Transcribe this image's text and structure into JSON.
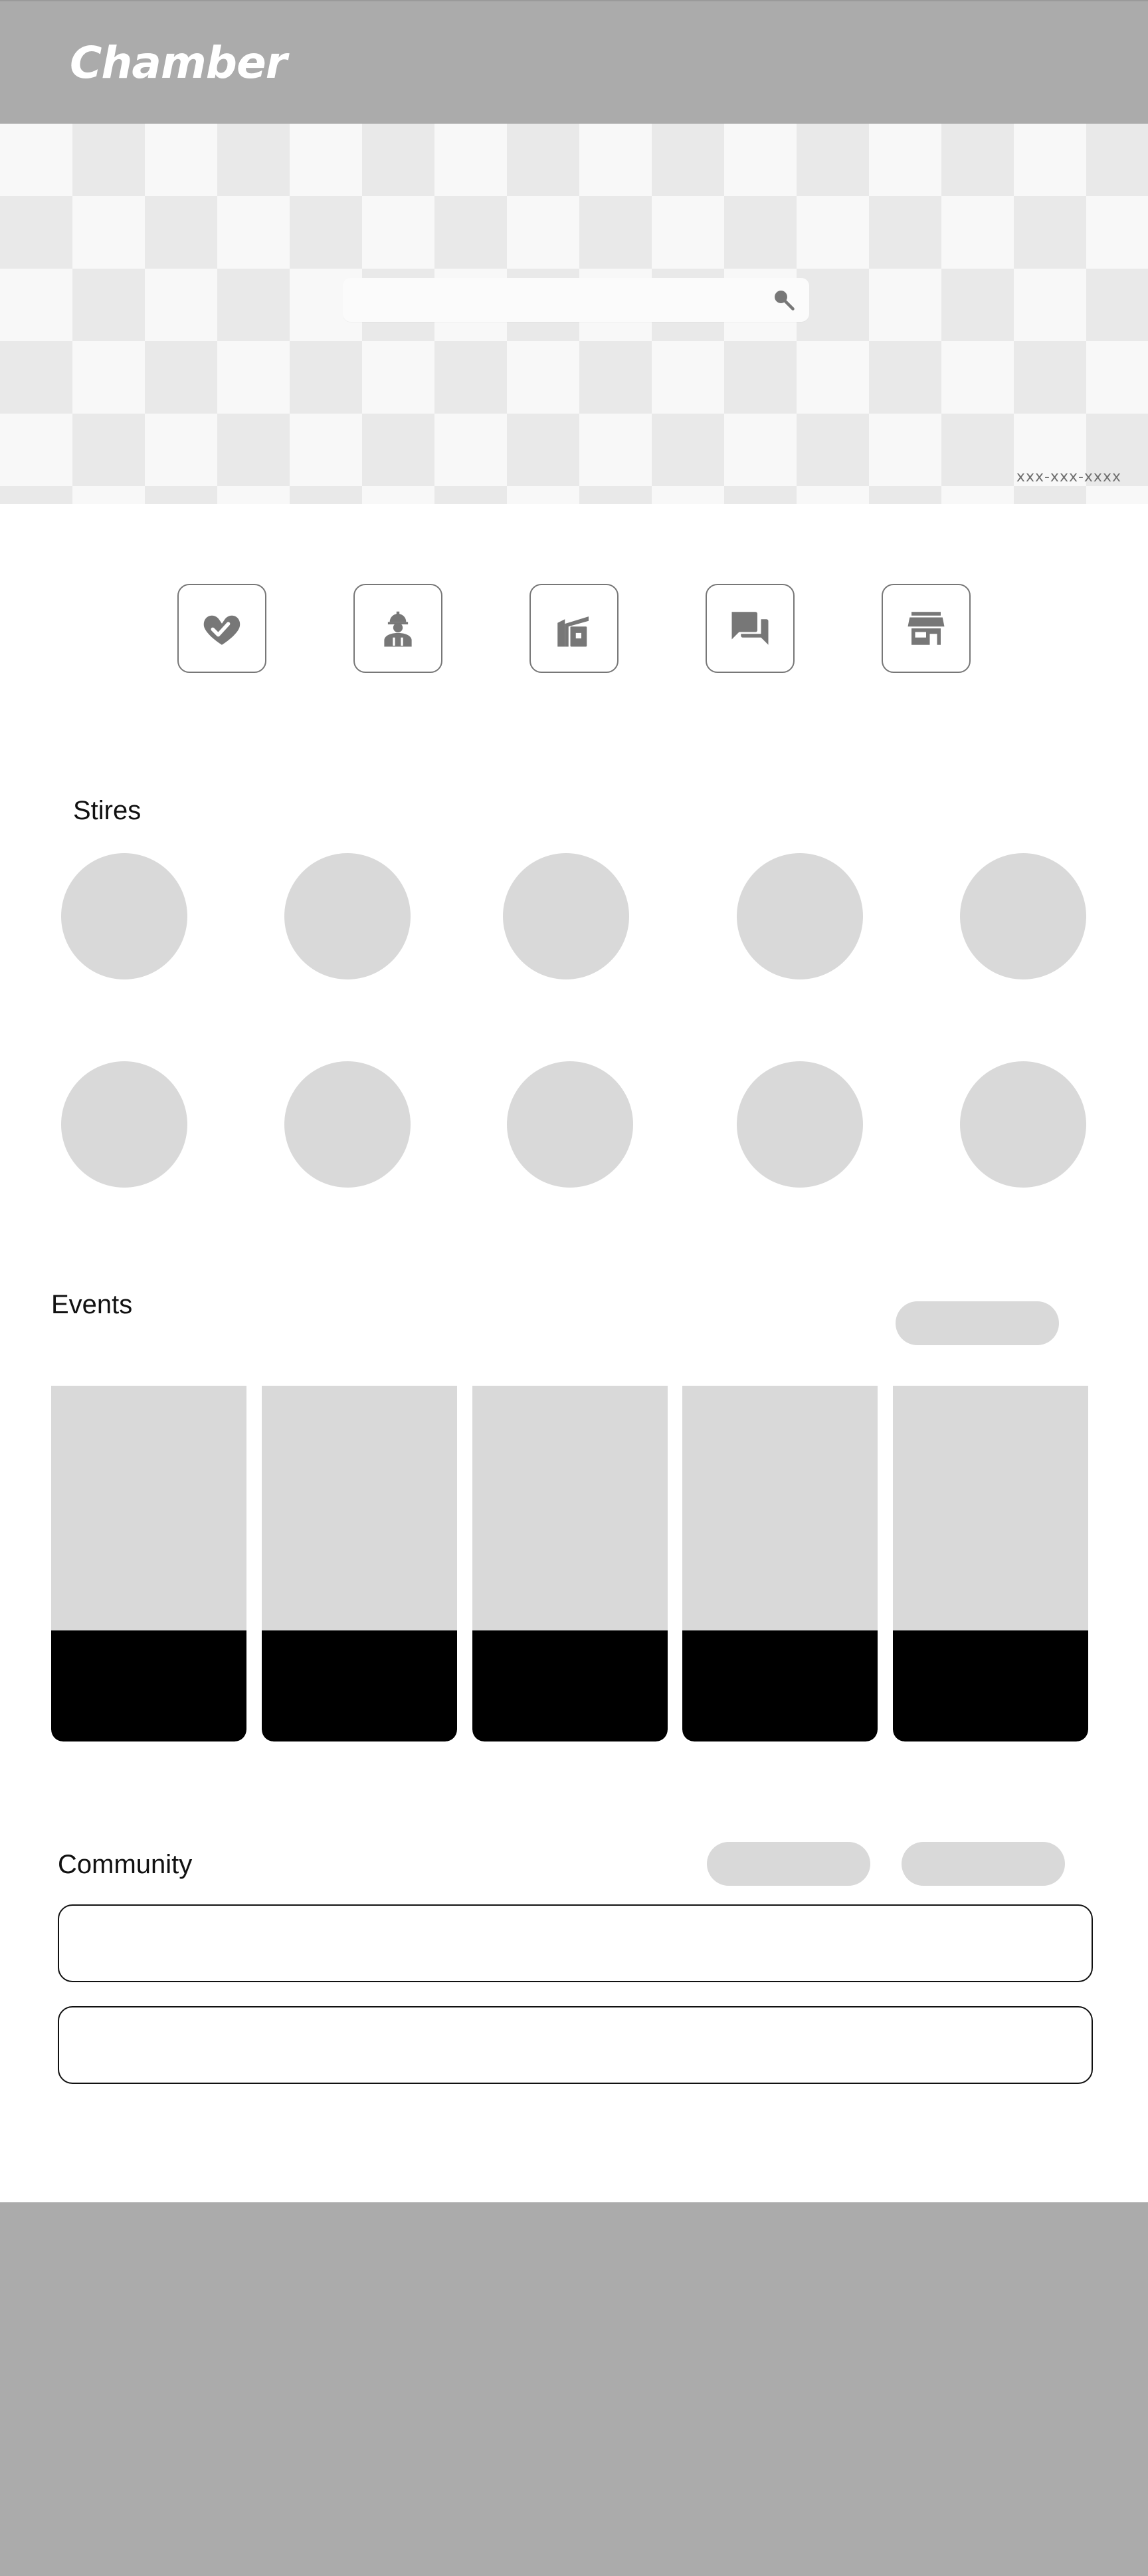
{
  "header": {
    "logo": "Chamber"
  },
  "hero": {
    "search": {
      "placeholder": "",
      "value": "",
      "icon": "search-icon"
    },
    "phone": "xxx-xxx-xxxx"
  },
  "quick_links": [
    {
      "icon": "handshake-heart-icon"
    },
    {
      "icon": "worker-icon"
    },
    {
      "icon": "factory-icon"
    },
    {
      "icon": "chat-bubbles-icon"
    },
    {
      "icon": "storefront-icon"
    }
  ],
  "stores": {
    "title": "Stires",
    "count": 10
  },
  "events": {
    "title": "Events",
    "card_count": 5
  },
  "community": {
    "title": "Community",
    "row_count": 2
  },
  "colors": {
    "header_bg": "#ababab",
    "footer_bg": "#ababab",
    "placeholder_gray": "#d9d9d9",
    "icon_gray": "#777777"
  }
}
